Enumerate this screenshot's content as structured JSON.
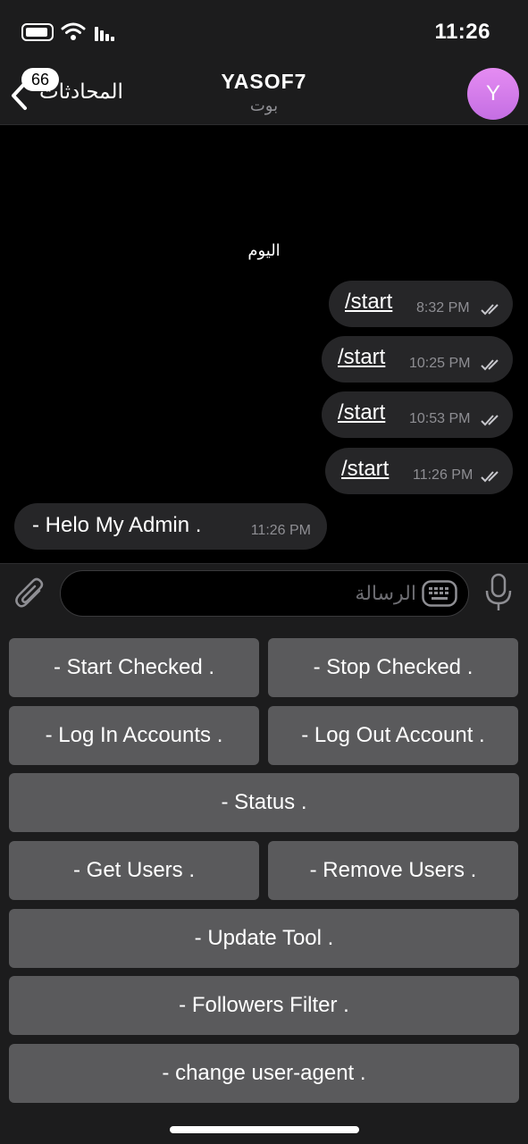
{
  "status_bar": {
    "time": "11:26",
    "icons": [
      "battery-icon",
      "wifi-icon",
      "signal-icon"
    ]
  },
  "header": {
    "back_label": "المحادثات",
    "badge_count": "66",
    "title": "YASOF7",
    "subtitle": "بوت",
    "avatar_letter": "Y",
    "avatar_color": "#d37ce9"
  },
  "chat": {
    "date_separator": "اليوم",
    "messages": [
      {
        "text": "/start",
        "time": "8:32 PM",
        "direction": "outgoing"
      },
      {
        "text": "/start",
        "time": "10:25 PM",
        "direction": "outgoing"
      },
      {
        "text": "/start",
        "time": "10:53 PM",
        "direction": "outgoing"
      },
      {
        "text": "/start",
        "time": "11:26 PM",
        "direction": "outgoing"
      },
      {
        "text": "- Helo My Admin  .",
        "time": "11:26 PM",
        "direction": "incoming"
      }
    ]
  },
  "input": {
    "placeholder": "الرسالة"
  },
  "keyboard": {
    "buttons": [
      "- Start Checked .",
      "- Stop Checked .",
      "- Log In Accounts .",
      "- Log Out Account .",
      "- Status .",
      "- Get Users .",
      "- Remove Users .",
      "- Update Tool .",
      "- Followers Filter .",
      "- change user-agent ."
    ]
  },
  "colors": {
    "background": "#000000",
    "bar": "#1c1c1d",
    "bubble": "#262628",
    "button": "#5a5a5c"
  }
}
